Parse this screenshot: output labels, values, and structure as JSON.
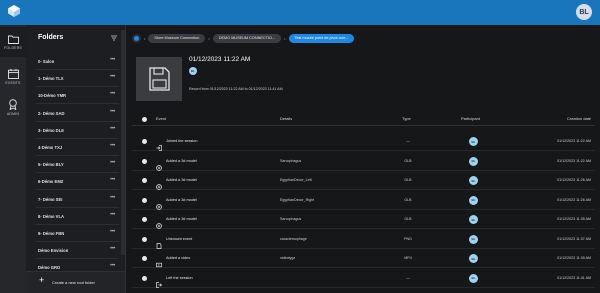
{
  "app": {
    "user_initials": "BL"
  },
  "rail": {
    "items": [
      {
        "label": "FOLDERS",
        "icon": "folder-icon"
      },
      {
        "label": "EVENTS",
        "icon": "calendar-icon"
      },
      {
        "label": "ADMIN",
        "icon": "admin-badge-icon"
      }
    ]
  },
  "sidebar": {
    "title": "Folders",
    "folders": [
      {
        "name": "0- Salon"
      },
      {
        "name": "1- Démo TLX"
      },
      {
        "name": "10-Démo YMR"
      },
      {
        "name": "2- Démo SAD"
      },
      {
        "name": "3- Démo DLE"
      },
      {
        "name": "4-Démo TXJ"
      },
      {
        "name": "5- Démo BLY"
      },
      {
        "name": "6-Démo EMZ"
      },
      {
        "name": "7- Démo SEI"
      },
      {
        "name": "8- Démo VLA"
      },
      {
        "name": "9- Démo FBN"
      },
      {
        "name": "Démo Envision"
      },
      {
        "name": "Démo GRD"
      }
    ],
    "more_label": "•••",
    "create_label": "Create a new root folder"
  },
  "breadcrumbs": [
    {
      "label": "Store Museum Connection",
      "active": false
    },
    {
      "label": "DEMO MUSEUM CONNECTIO...",
      "active": false
    },
    {
      "label": "Test musée point de pivot corr...",
      "active": true
    }
  ],
  "session": {
    "date": "01/12/2023 11:22 AM",
    "badge": "BL",
    "record": "Record from 01/12/2023 11:22 AM to 01/12/2023 11:41 AM"
  },
  "table": {
    "headers": {
      "event": "Event",
      "details": "Details",
      "type": "Type",
      "participant": "Participant",
      "creation_date": "Creation date"
    },
    "rows": [
      {
        "event": "Joined the session",
        "icon": "login-icon",
        "details": "",
        "type": "—",
        "participant": "BL",
        "date": "01/12/2023 11:22 AM"
      },
      {
        "event": "Added a 3d model",
        "icon": "cube-add-icon",
        "details": "Sarcophagus",
        "type": "GLB",
        "participant": "BL",
        "date": "01/12/2023 11:22 AM"
      },
      {
        "event": "Added a 3d model",
        "icon": "cube-add-icon",
        "details": "EgyptianDecor_Left",
        "type": "GLB",
        "participant": "BL",
        "date": "01/12/2023 11:26 AM"
      },
      {
        "event": "Added a 3d model",
        "icon": "cube-add-icon",
        "details": "EgyptianDecor_Right",
        "type": "GLB",
        "participant": "BL",
        "date": "01/12/2023 11:26 AM"
      },
      {
        "event": "Added a 3d model",
        "icon": "cube-add-icon",
        "details": "Sarcophagus",
        "type": "GLB",
        "participant": "BL",
        "date": "01/12/2023 11:35 AM"
      },
      {
        "event": "Unknown event",
        "icon": "document-icon",
        "details": "caractersophage",
        "type": "PNG",
        "participant": "BL",
        "date": "01/12/2023 11:37 AM"
      },
      {
        "event": "Added a video",
        "icon": "video-icon",
        "details": "vidéotygz",
        "type": "MP4",
        "participant": "BL",
        "date": "01/12/2023 11:39 AM"
      },
      {
        "event": "Left the session",
        "icon": "logout-icon",
        "details": "",
        "type": "—",
        "participant": "BL",
        "date": "01/12/2023 11:41 AM"
      }
    ]
  }
}
